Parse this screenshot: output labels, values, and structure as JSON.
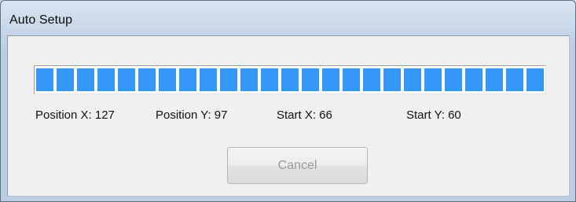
{
  "window": {
    "title": "Auto Setup"
  },
  "progress": {
    "fraction": 1.0
  },
  "status": {
    "position_x": "Position X: 127",
    "position_y": "Position Y: 97",
    "start_x": "Start X: 66",
    "start_y": "Start Y: 60"
  },
  "buttons": {
    "cancel": "Cancel",
    "cancel_enabled": false
  },
  "colors": {
    "progress_fill": "#3397f8",
    "disabled_text": "#9a9a9a"
  }
}
